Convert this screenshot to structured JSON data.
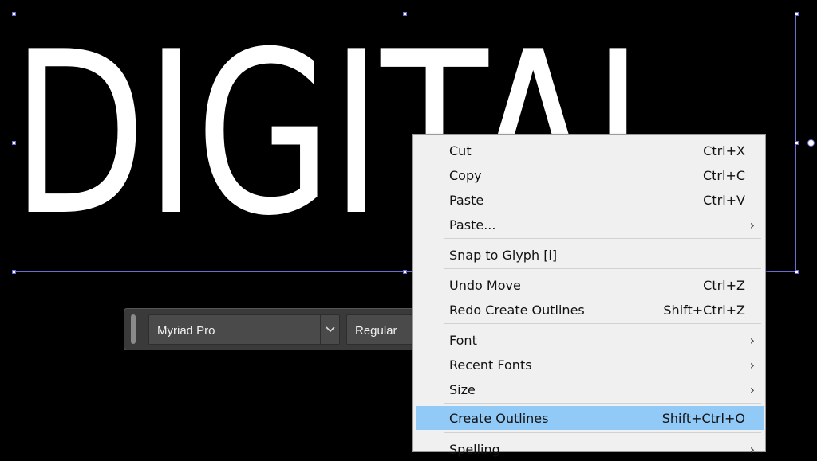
{
  "artboard": {
    "text": "DIGITAL"
  },
  "font_toolbar": {
    "font_family": "Myriad Pro",
    "font_style": "Regular"
  },
  "context_menu": {
    "cut": {
      "label": "Cut",
      "shortcut": "Ctrl+X"
    },
    "copy": {
      "label": "Copy",
      "shortcut": "Ctrl+C"
    },
    "paste": {
      "label": "Paste",
      "shortcut": "Ctrl+V"
    },
    "paste_special": {
      "label": "Paste..."
    },
    "snap_to_glyph": {
      "label": "Snap to Glyph [i]"
    },
    "undo": {
      "label": "Undo Move",
      "shortcut": "Ctrl+Z"
    },
    "redo": {
      "label": "Redo Create Outlines",
      "shortcut": "Shift+Ctrl+Z"
    },
    "font": {
      "label": "Font"
    },
    "recent_fonts": {
      "label": "Recent Fonts"
    },
    "size": {
      "label": "Size"
    },
    "create_outlines": {
      "label": "Create Outlines",
      "shortcut": "Shift+Ctrl+O"
    },
    "spelling": {
      "label": "Spelling"
    },
    "submenu_arrow": "›"
  },
  "colors": {
    "highlight": "#91c9f7",
    "selection": "#6b6bd6",
    "menu_bg": "#f0f0f0"
  }
}
